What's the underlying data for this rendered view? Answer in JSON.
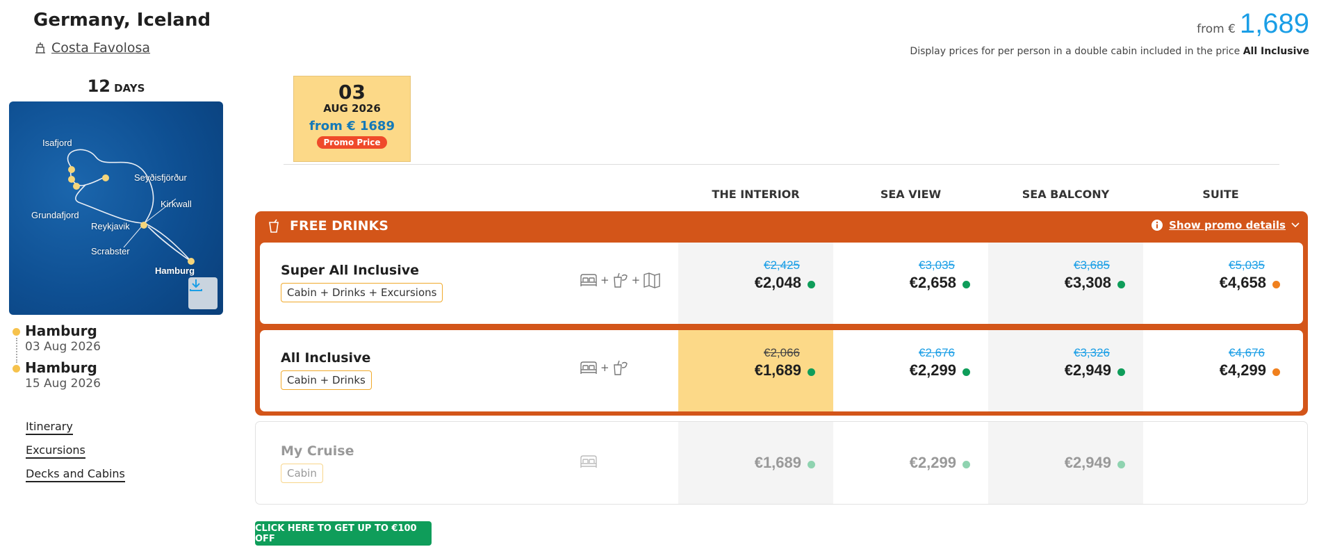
{
  "header": {
    "title": "Germany, Iceland",
    "ship": "Costa Favolosa",
    "from_prefix": "from €",
    "from_price": "1,689",
    "display_note": "Display prices for per person in a double cabin included in the price",
    "display_note_bold": "All Inclusive"
  },
  "duration": {
    "number": "12",
    "unit": "DAYS"
  },
  "map": {
    "ports": [
      "Isafjord",
      "Seyðisfjörður",
      "Kirkwall",
      "Grundafjord",
      "Reykjavik",
      "Scrabster",
      "Hamburg"
    ]
  },
  "route": [
    {
      "city": "Hamburg",
      "date": "03 Aug 2026"
    },
    {
      "city": "Hamburg",
      "date": "15 Aug 2026"
    }
  ],
  "side_links": [
    "Itinerary",
    "Excursions",
    "Decks and Cabins"
  ],
  "date_tile": {
    "day": "03",
    "month": "AUG 2026",
    "from": "from € 1689",
    "badge": "Promo Price"
  },
  "columns": [
    "THE INTERIOR",
    "SEA VIEW",
    "SEA BALCONY",
    "SUITE"
  ],
  "promo": {
    "title": "FREE DRINKS",
    "details_label": "Show promo details"
  },
  "rows": [
    {
      "name": "Super All Inclusive",
      "tag": "Cabin + Drinks + Excursions",
      "prices": [
        {
          "old": "€2,425",
          "now": "€2,048",
          "status": "#0f9d5a"
        },
        {
          "old": "€3,035",
          "now": "€2,658",
          "status": "#0f9d5a"
        },
        {
          "old": "€3,685",
          "now": "€3,308",
          "status": "#0f9d5a"
        },
        {
          "old": "€5,035",
          "now": "€4,658",
          "status": "#f0801e"
        }
      ]
    },
    {
      "name": "All Inclusive",
      "tag": "Cabin + Drinks",
      "prices": [
        {
          "old": "€2,066",
          "now": "€1,689",
          "status": "#0f9d5a"
        },
        {
          "old": "€2,676",
          "now": "€2,299",
          "status": "#0f9d5a"
        },
        {
          "old": "€3,326",
          "now": "€2,949",
          "status": "#0f9d5a"
        },
        {
          "old": "€4,676",
          "now": "€4,299",
          "status": "#f0801e"
        }
      ]
    },
    {
      "name": "My Cruise",
      "tag": "Cabin",
      "prices": [
        {
          "now": "€1,689",
          "status": "#8fd3b0"
        },
        {
          "now": "€2,299",
          "status": "#8fd3b0"
        },
        {
          "now": "€2,949",
          "status": "#8fd3b0"
        }
      ]
    }
  ],
  "cta": "CLICK HERE TO GET UP TO €100 OFF",
  "colors": {
    "accent_blue": "#1a9ee6",
    "promo_orange": "#d35519",
    "highlight": "#fcd988",
    "cta_green": "#0f9d5a"
  }
}
